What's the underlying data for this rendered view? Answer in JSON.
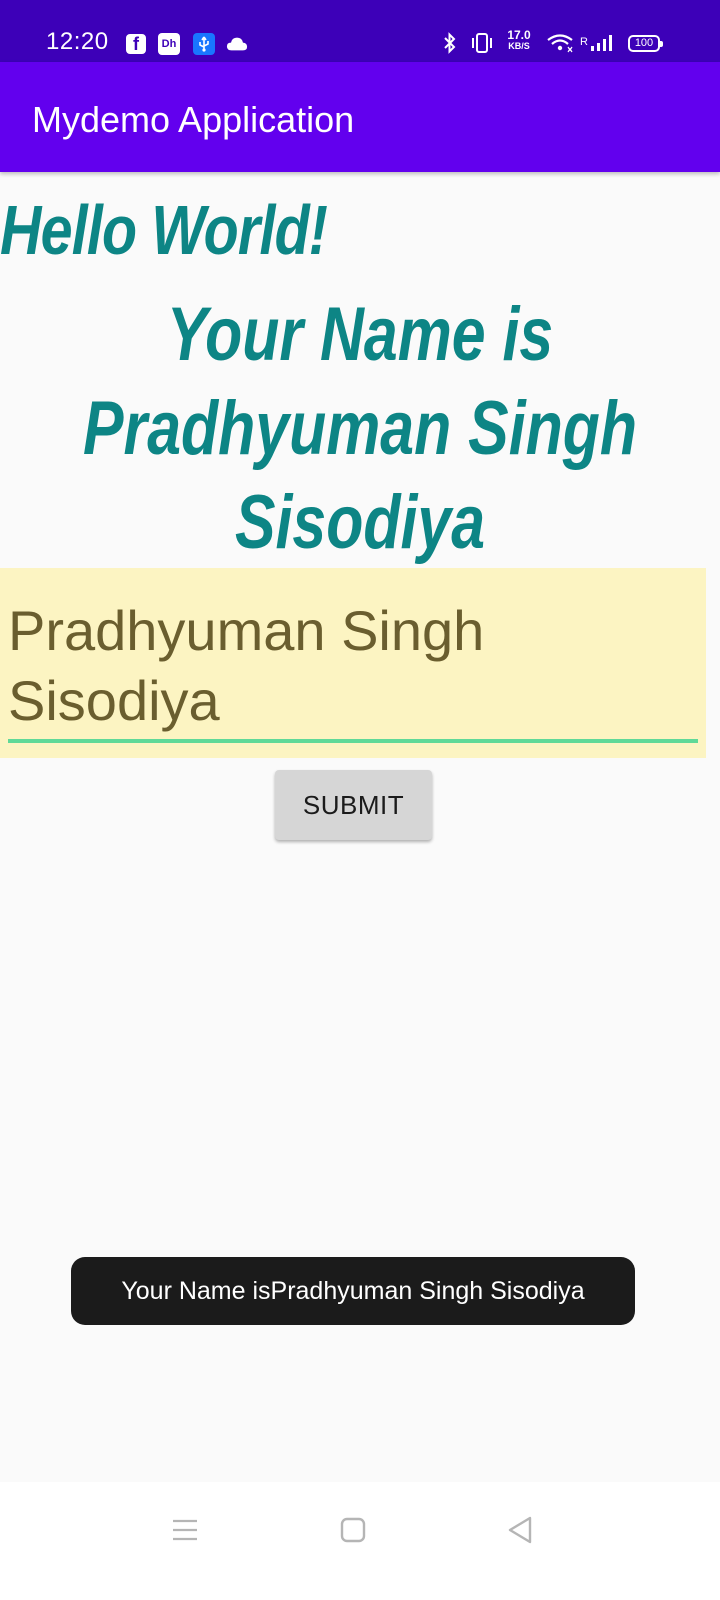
{
  "status_bar": {
    "time": "12:20",
    "notif_icons": [
      "facebook-icon",
      "dailyhunt-icon",
      "usb-icon",
      "cloud-icon"
    ],
    "speed_value": "17.0",
    "speed_unit": "KB/S",
    "roaming": "R",
    "battery": "100",
    "background": "#3d00b8"
  },
  "app_bar": {
    "title": "Mydemo Application",
    "background": "#6200ee"
  },
  "main": {
    "hello_text": "Hello World!",
    "name_lines": [
      "Your Name is",
      "Pradhyuman Singh",
      "Sisodiya"
    ],
    "text_color": "#0d8585",
    "input_value_lines": [
      "Pradhyuman Singh",
      "Sisodiya"
    ],
    "input_background": "#fcf4c2",
    "submit_label": "SUBMIT"
  },
  "toast": {
    "message": "Your Name isPradhyuman Singh Sisodiya"
  },
  "nav_bar": {
    "buttons": [
      "menu-icon",
      "home-icon",
      "back-icon"
    ]
  }
}
